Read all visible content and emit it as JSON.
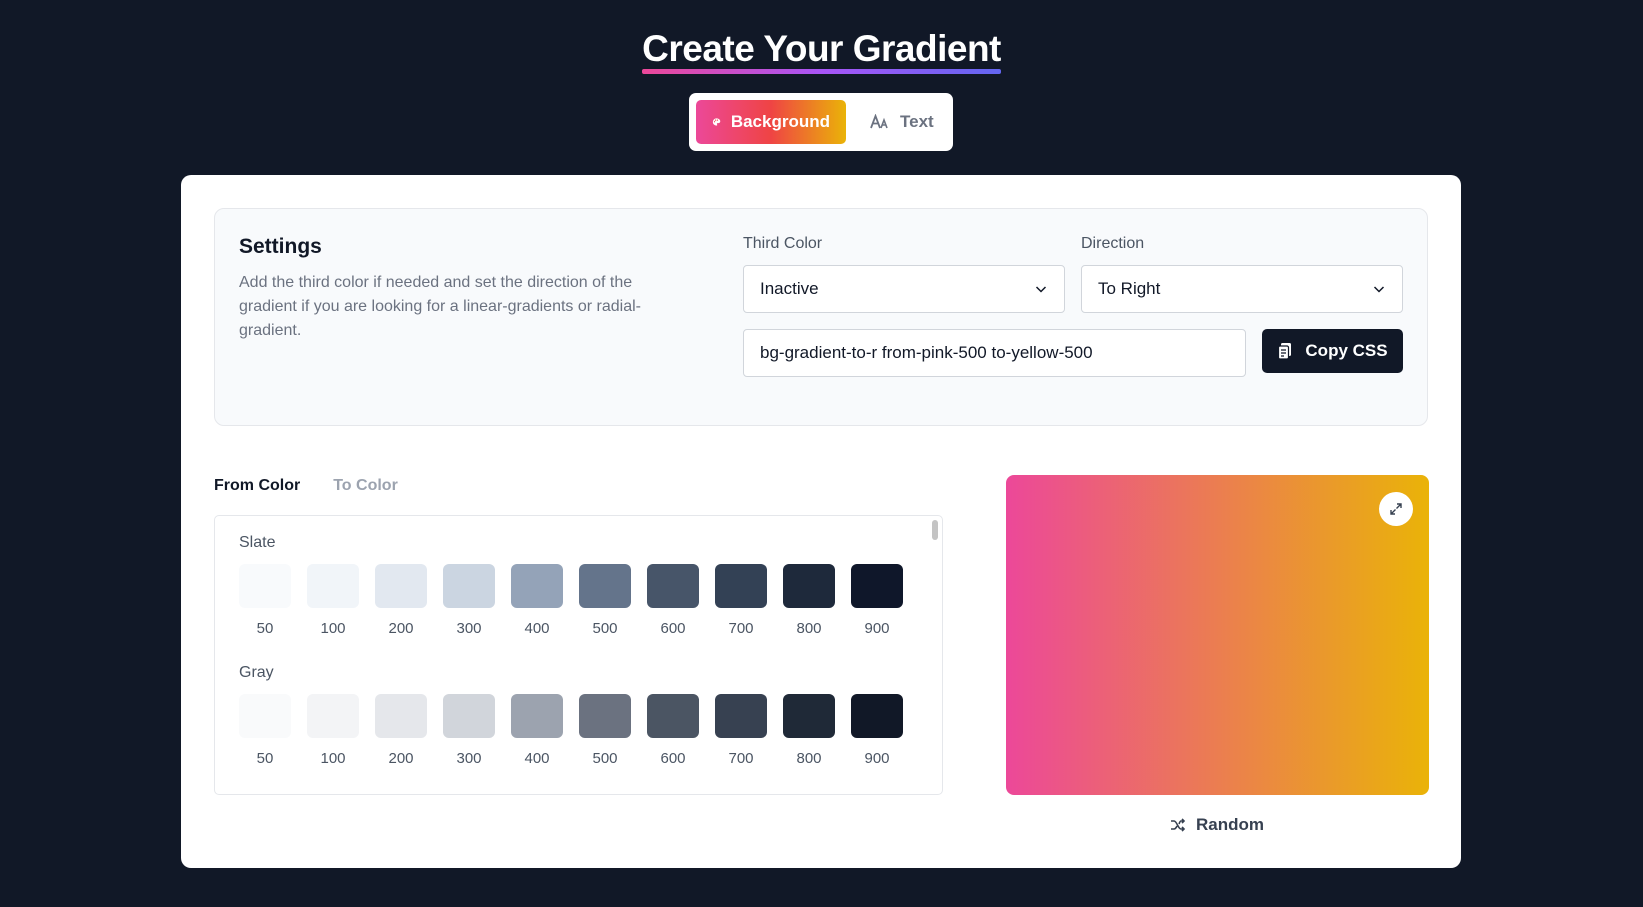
{
  "header": {
    "title": "Create Your Gradient"
  },
  "mode_switch": {
    "items": [
      {
        "label": "Background",
        "icon": "palette-icon",
        "active": true
      },
      {
        "label": "Text",
        "icon": "text-size-icon",
        "active": false
      }
    ]
  },
  "settings": {
    "title": "Settings",
    "description": "Add the third color if needed and set the direction of the gradient if you are looking for a linear-gradients or radial-gradient.",
    "third_color": {
      "label": "Third Color",
      "value": "Inactive"
    },
    "direction": {
      "label": "Direction",
      "value": "To Right"
    },
    "css_output": "bg-gradient-to-r from-pink-500 to-yellow-500",
    "copy_label": "Copy CSS"
  },
  "color_tabs": [
    {
      "label": "From Color",
      "active": true
    },
    {
      "label": "To Color",
      "active": false
    }
  ],
  "palette": {
    "groups": [
      {
        "name": "Slate",
        "colors": [
          "#f8fafc",
          "#f1f5f9",
          "#e2e8f0",
          "#cbd5e1",
          "#94a3b8",
          "#64748b",
          "#475569",
          "#334155",
          "#1e293b",
          "#0f172a"
        ]
      },
      {
        "name": "Gray",
        "colors": [
          "#f9fafb",
          "#f3f4f6",
          "#e5e7eb",
          "#d1d5db",
          "#9ca3af",
          "#6b7280",
          "#4b5563",
          "#374151",
          "#1f2937",
          "#111827"
        ]
      }
    ],
    "shades": [
      "50",
      "100",
      "200",
      "300",
      "400",
      "500",
      "600",
      "700",
      "800",
      "900"
    ]
  },
  "preview": {
    "from": "#ec4899",
    "to": "#eab308",
    "expand_icon": "expand-icon"
  },
  "random": {
    "label": "Random",
    "icon": "shuffle-icon"
  }
}
